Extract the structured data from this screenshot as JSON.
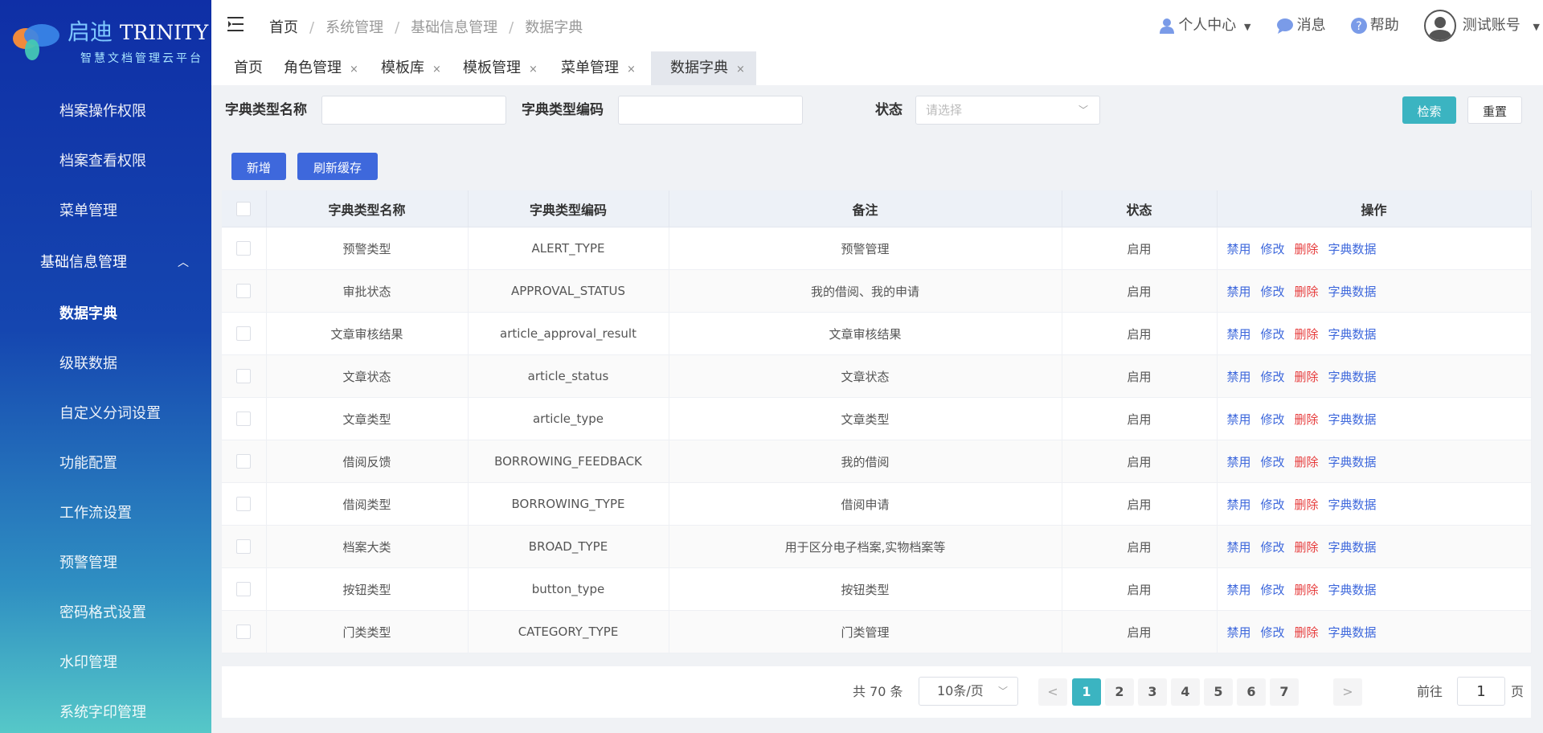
{
  "brand": {
    "title_cn": "启迪",
    "title_en": "TRINITY",
    "subtitle": "智慧文档管理云平台"
  },
  "sidebar": {
    "items_top": [
      {
        "label": "档案操作权限"
      },
      {
        "label": "档案查看权限"
      },
      {
        "label": "菜单管理"
      }
    ],
    "group": {
      "label": "基础信息管理",
      "expanded": true
    },
    "items_sub": [
      {
        "label": "数据字典",
        "active": true
      },
      {
        "label": "级联数据"
      },
      {
        "label": "自定义分词设置"
      },
      {
        "label": "功能配置"
      },
      {
        "label": "工作流设置"
      },
      {
        "label": "预警管理"
      },
      {
        "label": "密码格式设置"
      },
      {
        "label": "水印管理"
      },
      {
        "label": "系统字印管理"
      }
    ]
  },
  "header": {
    "breadcrumb": [
      "首页",
      "系统管理",
      "基础信息管理",
      "数据字典"
    ],
    "personal_center": "个人中心",
    "messages": "消息",
    "help": "帮助",
    "account": "测试账号"
  },
  "tabs": [
    {
      "label": "首页",
      "closable": false
    },
    {
      "label": "角色管理",
      "closable": true
    },
    {
      "label": "模板库",
      "closable": true
    },
    {
      "label": "模板管理",
      "closable": true
    },
    {
      "label": "菜单管理",
      "closable": true
    },
    {
      "label": "数据字典",
      "closable": true,
      "active": true
    }
  ],
  "tab_close": "×",
  "filters": {
    "name_label": "字典类型名称",
    "name_value": "",
    "code_label": "字典类型编码",
    "code_value": "",
    "status_label": "状态",
    "status_placeholder": "请选择"
  },
  "buttons": {
    "search": "检索",
    "reset": "重置",
    "add": "新增",
    "refresh_cache": "刷新缓存"
  },
  "table": {
    "columns": [
      "字典类型名称",
      "字典类型编码",
      "备注",
      "状态",
      "操作"
    ],
    "ops": {
      "disable": "禁用",
      "edit": "修改",
      "delete": "删除",
      "dict_data": "字典数据"
    },
    "rows": [
      {
        "name": "预警类型",
        "code": "ALERT_TYPE",
        "remark": "预警管理",
        "status": "启用"
      },
      {
        "name": "审批状态",
        "code": "APPROVAL_STATUS",
        "remark": "我的借阅、我的申请",
        "status": "启用"
      },
      {
        "name": "文章审核结果",
        "code": "article_approval_result",
        "remark": "文章审核结果",
        "status": "启用"
      },
      {
        "name": "文章状态",
        "code": "article_status",
        "remark": "文章状态",
        "status": "启用"
      },
      {
        "name": "文章类型",
        "code": "article_type",
        "remark": "文章类型",
        "status": "启用"
      },
      {
        "name": "借阅反馈",
        "code": "BORROWING_FEEDBACK",
        "remark": "我的借阅",
        "status": "启用"
      },
      {
        "name": "借阅类型",
        "code": "BORROWING_TYPE",
        "remark": "借阅申请",
        "status": "启用"
      },
      {
        "name": "档案大类",
        "code": "BROAD_TYPE",
        "remark": "用于区分电子档案,实物档案等",
        "status": "启用"
      },
      {
        "name": "按钮类型",
        "code": "button_type",
        "remark": "按钮类型",
        "status": "启用"
      },
      {
        "name": "门类类型",
        "code": "CATEGORY_TYPE",
        "remark": "门类管理",
        "status": "启用"
      }
    ]
  },
  "pagination": {
    "total": "共 70 条",
    "page_size": "10条/页",
    "prev": "<",
    "next": ">",
    "pages": [
      "1",
      "2",
      "3",
      "4",
      "5",
      "6",
      "7"
    ],
    "current": "1",
    "goto_label": "前往",
    "goto_value": "1",
    "goto_unit": "页"
  }
}
